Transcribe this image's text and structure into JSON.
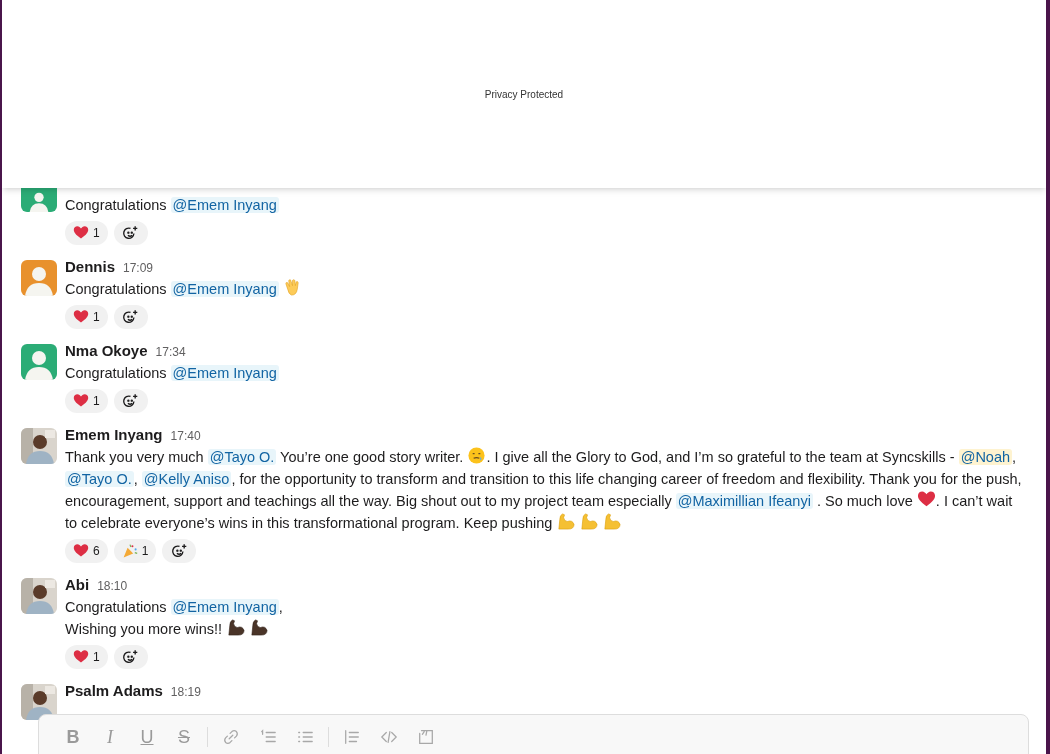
{
  "banner": {
    "text": "Privacy Protected"
  },
  "messages": [
    {
      "avatar": {
        "kind": "default",
        "color": "#2bac76"
      },
      "parts": [
        {
          "kind": "text",
          "text": "Congratulations "
        },
        {
          "kind": "mention",
          "text": "@Emem Inyang"
        }
      ],
      "reactions": [
        {
          "kind": "heart",
          "count": "1"
        }
      ]
    },
    {
      "name": "Dennis",
      "time": "17:09",
      "avatar": {
        "kind": "default",
        "color": "#e8912d"
      },
      "parts": [
        {
          "kind": "text",
          "text": "Congratulations "
        },
        {
          "kind": "mention",
          "text": "@Emem Inyang"
        },
        {
          "kind": "wave_emoji"
        }
      ],
      "reactions": [
        {
          "kind": "heart",
          "count": "1"
        }
      ]
    },
    {
      "name": "Nma Okoye",
      "time": "17:34",
      "avatar": {
        "kind": "default",
        "color": "#2bac76"
      },
      "parts": [
        {
          "kind": "text",
          "text": "Congratulations "
        },
        {
          "kind": "mention",
          "text": "@Emem Inyang"
        }
      ],
      "reactions": [
        {
          "kind": "heart",
          "count": "1"
        }
      ]
    },
    {
      "name": "Emem Inyang",
      "time": "17:40",
      "avatar": {
        "kind": "picture"
      },
      "parts": [
        {
          "kind": "text",
          "text": "Thank you very much "
        },
        {
          "kind": "mention",
          "text": "@Tayo O."
        },
        {
          "kind": "text",
          "text": " You’re one good story writer. "
        },
        {
          "kind": "tear_smile_emoji"
        },
        {
          "kind": "text",
          "text": ". I give all the Glory to God, and I’m so grateful to the team at Syncskills - "
        },
        {
          "kind": "self_mention",
          "text": "@Noah"
        },
        {
          "kind": "text",
          "text": ", "
        },
        {
          "kind": "mention",
          "text": "@Tayo O."
        },
        {
          "kind": "text",
          "text": ", "
        },
        {
          "kind": "mention",
          "text": "@Kelly Aniso"
        },
        {
          "kind": "text",
          "text": ", for the opportunity to transform and transition to this life changing career of freedom and flexibility. Thank you for the push, encouragement, support and teachings all the way. Big shout out to my project team especially "
        },
        {
          "kind": "mention",
          "text": "@Maximillian Ifeanyi"
        },
        {
          "kind": "text",
          "text": " . So much love "
        },
        {
          "kind": "heart_emoji"
        },
        {
          "kind": "text",
          "text": ". I can’t wait to celebrate everyone’s wins in this transformational program. Keep pushing "
        },
        {
          "kind": "muscle_emoji"
        },
        {
          "kind": "muscle_emoji"
        },
        {
          "kind": "muscle_emoji"
        }
      ],
      "reactions": [
        {
          "kind": "heart",
          "count": "6"
        },
        {
          "kind": "party",
          "count": "1"
        }
      ]
    },
    {
      "name": "Abi",
      "time": "18:10",
      "avatar": {
        "kind": "picture"
      },
      "parts": [
        {
          "kind": "text",
          "text": "Congratulations "
        },
        {
          "kind": "mention",
          "text": "@Emem Inyang"
        },
        {
          "kind": "text",
          "text": ","
        },
        {
          "kind": "break"
        },
        {
          "kind": "text",
          "text": "Wishing you more wins!! "
        },
        {
          "kind": "dark_muscle_emoji"
        },
        {
          "kind": "dark_muscle_emoji"
        }
      ],
      "reactions": [
        {
          "kind": "heart",
          "count": "1"
        }
      ]
    },
    {
      "name": "Psalm Adams",
      "time": "18:19",
      "avatar": {
        "kind": "picture"
      }
    }
  ],
  "composer": {
    "disabled": true,
    "tools": [
      {
        "kind": "bold",
        "label": "B"
      },
      {
        "kind": "italic",
        "label": "I"
      },
      {
        "kind": "underline",
        "label": "U"
      },
      {
        "kind": "strike",
        "label": "S"
      },
      {
        "kind": "divider"
      },
      {
        "kind": "link"
      },
      {
        "kind": "numbered_list"
      },
      {
        "kind": "bulleted_list"
      },
      {
        "kind": "divider"
      },
      {
        "kind": "quote"
      },
      {
        "kind": "code"
      },
      {
        "kind": "code_block"
      }
    ]
  }
}
